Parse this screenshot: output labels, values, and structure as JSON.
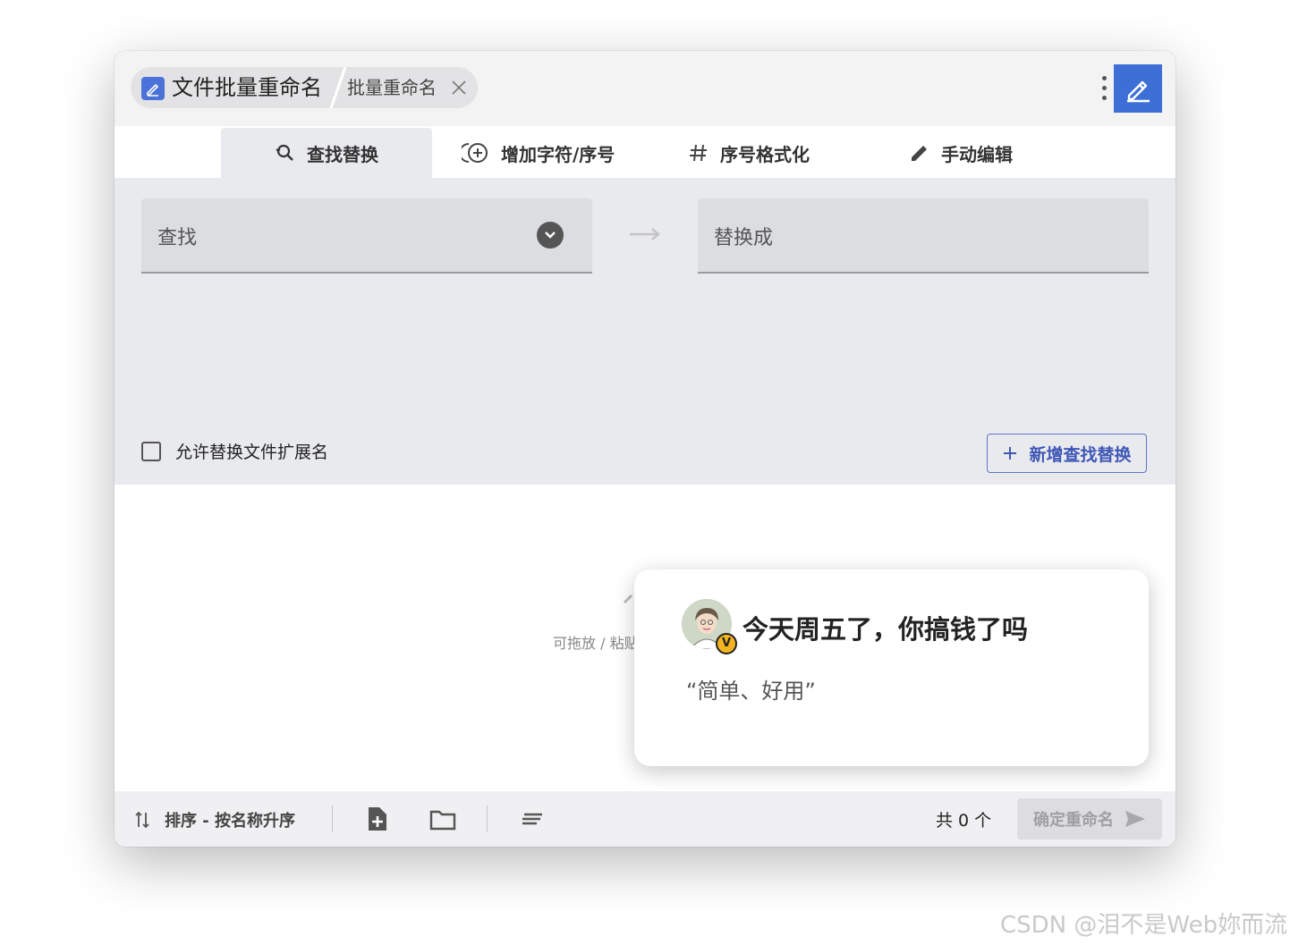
{
  "window": {
    "app_name": "文件批量重命名",
    "sub_name": "批量重命名"
  },
  "tabs": [
    {
      "label": "查找替换",
      "icon": "find-replace-icon",
      "active": true
    },
    {
      "label": "增加字符/序号",
      "icon": "add-circle-icon",
      "active": false
    },
    {
      "label": "序号格式化",
      "icon": "hash-icon",
      "active": false
    },
    {
      "label": "手动编辑",
      "icon": "pencil-icon",
      "active": false
    }
  ],
  "find_replace": {
    "find_label": "查找",
    "replace_label": "替换成",
    "allow_ext_label": "允许替换文件扩展名",
    "allow_ext_checked": false,
    "add_button_label": "新增查找替换"
  },
  "content": {
    "drop_hint": "可拖放 / 粘贴"
  },
  "bottom": {
    "sort_label": "排序 - 按名称升序",
    "count_label": "共 0 个",
    "confirm_label": "确定重命名"
  },
  "popup": {
    "title": "今天周五了，你搞钱了吗",
    "quote": "“简单、好用”",
    "badge": "V"
  },
  "watermark": "CSDN @泪不是Web妳而流",
  "colors": {
    "accent": "#3e6fd6",
    "button_text": "#3f57b5",
    "panel_bg": "#e9eaee",
    "field_bg": "#dcdde1"
  }
}
